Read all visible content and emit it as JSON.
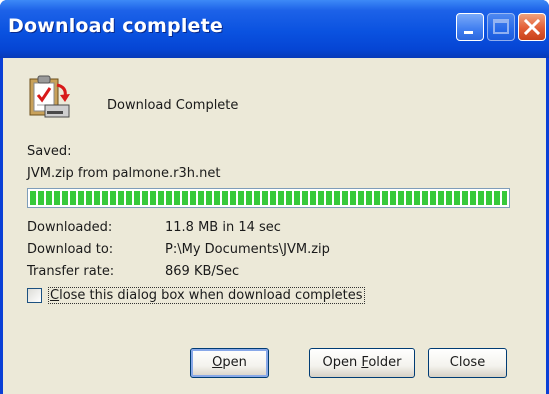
{
  "window": {
    "title": "Download complete",
    "controls": [
      "minimize-icon",
      "maximize-icon",
      "close-icon"
    ]
  },
  "dialog": {
    "icon": "download-complete-icon",
    "heading": "Download Complete",
    "saved_label": "Saved:",
    "saved_file": "JVM.zip from palmone.r3h.net",
    "progress": 1.0,
    "details": [
      {
        "label": "Downloaded:",
        "value": "11.8 MB in 14 sec"
      },
      {
        "label": "Download to:",
        "value": "P:\\My Documents\\JVM.zip"
      },
      {
        "label": "Transfer rate:",
        "value": "869 KB/Sec"
      }
    ],
    "close_checkbox": {
      "label_prefix": "",
      "label_mnemonic": "C",
      "label_rest": "lose this dialog box when download completes",
      "checked": false
    }
  },
  "buttons": {
    "open": {
      "mnemonic": "O",
      "rest": "pen"
    },
    "open_folder": {
      "prefix": "Open ",
      "mnemonic": "F",
      "rest": "older"
    },
    "close": "Close"
  },
  "colors": {
    "titlebar": "#0a52e0",
    "progress_fill": "#37c93a",
    "client_bg": "#ece9d8"
  }
}
